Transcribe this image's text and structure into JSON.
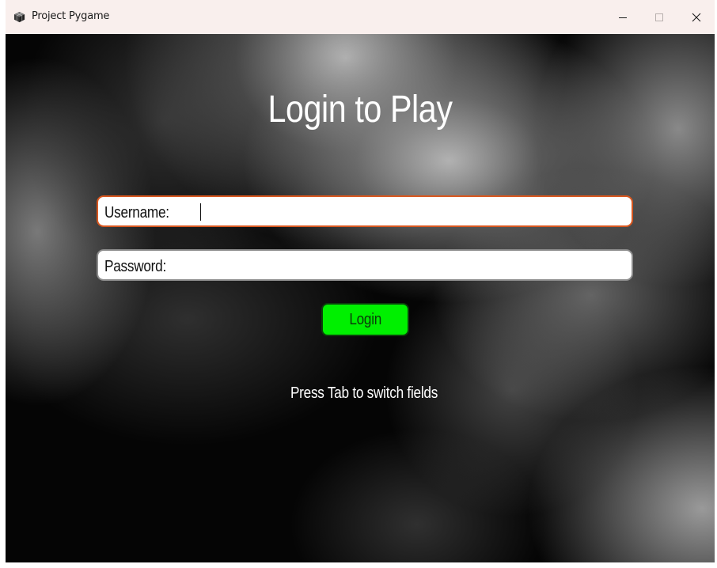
{
  "window": {
    "title": "Project Pygame",
    "icon": "pygame-cube-icon",
    "controls": [
      "minimize-icon",
      "maximize-icon",
      "close-icon"
    ]
  },
  "login": {
    "heading": "Login to Play",
    "username_label": "Username:",
    "username_value": "",
    "password_label": "Password:",
    "password_value": "",
    "button_label": "Login",
    "hint": "Press Tab to switch fields"
  },
  "colors": {
    "titlebar": "#f9efed",
    "active_field_border": "#d8571f",
    "inactive_field_border": "#8c8c8c",
    "button": "#00f000",
    "text_light": "#ffffff"
  }
}
